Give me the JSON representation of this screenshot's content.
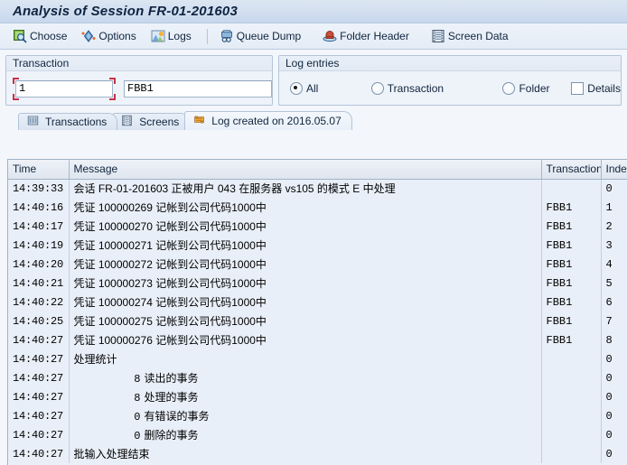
{
  "window": {
    "title": "Analysis of Session FR-01-201603"
  },
  "toolbar": {
    "buttons": [
      {
        "label": "Choose",
        "icon": "choose-magnifier-icon"
      },
      {
        "label": "Options",
        "icon": "options-diamond-icon"
      },
      {
        "label": "Logs",
        "icon": "logs-mountain-icon"
      },
      {
        "label": "Queue Dump",
        "icon": "queue-dump-icon"
      },
      {
        "label": "Folder Header",
        "icon": "folder-header-icon"
      },
      {
        "label": "Screen Data",
        "icon": "screen-data-filmstrip-icon"
      }
    ]
  },
  "transaction_group": {
    "title": "Transaction",
    "index_field": {
      "value": "1",
      "placeholder": ""
    },
    "code_field": {
      "value": "FBB1",
      "placeholder": ""
    }
  },
  "log_entries_group": {
    "title": "Log entries",
    "radios": [
      {
        "label": "All",
        "selected": true
      },
      {
        "label": "Transaction",
        "selected": false
      },
      {
        "label": "Folder",
        "selected": false
      }
    ],
    "checkbox": {
      "label": "Details",
      "checked": false
    }
  },
  "tabs": [
    {
      "label": "Transactions",
      "icon": "grid-columns-icon",
      "active": false
    },
    {
      "label": "Screens",
      "icon": "filmstrip-icon",
      "active": false
    },
    {
      "label": "Log created on 2016.05.07",
      "icon": "log-scroll-icon",
      "active": true
    }
  ],
  "table": {
    "columns": [
      "Time",
      "Message",
      "Transaction",
      "Inde"
    ],
    "rows": [
      {
        "time": "14:39:33",
        "message": "会话 FR-01-201603 正被用户 043 在服务器 vs105 的模式 E 中处理",
        "transaction": "",
        "index": "0",
        "stat": ""
      },
      {
        "time": "14:40:16",
        "message": "凭证 100000269 记帐到公司代码1000中",
        "transaction": "FBB1",
        "index": "1",
        "stat": ""
      },
      {
        "time": "14:40:17",
        "message": "凭证 100000270 记帐到公司代码1000中",
        "transaction": "FBB1",
        "index": "2",
        "stat": ""
      },
      {
        "time": "14:40:19",
        "message": "凭证 100000271 记帐到公司代码1000中",
        "transaction": "FBB1",
        "index": "3",
        "stat": ""
      },
      {
        "time": "14:40:20",
        "message": "凭证 100000272 记帐到公司代码1000中",
        "transaction": "FBB1",
        "index": "4",
        "stat": ""
      },
      {
        "time": "14:40:21",
        "message": "凭证 100000273 记帐到公司代码1000中",
        "transaction": "FBB1",
        "index": "5",
        "stat": ""
      },
      {
        "time": "14:40:22",
        "message": "凭证 100000274 记帐到公司代码1000中",
        "transaction": "FBB1",
        "index": "6",
        "stat": ""
      },
      {
        "time": "14:40:25",
        "message": "凭证 100000275 记帐到公司代码1000中",
        "transaction": "FBB1",
        "index": "7",
        "stat": ""
      },
      {
        "time": "14:40:27",
        "message": "凭证 100000276 记帐到公司代码1000中",
        "transaction": "FBB1",
        "index": "8",
        "stat": ""
      },
      {
        "time": "14:40:27",
        "message": "处理统计",
        "transaction": "",
        "index": "0",
        "stat": ""
      },
      {
        "time": "14:40:27",
        "message": "读出的事务",
        "transaction": "",
        "index": "0",
        "stat": "8"
      },
      {
        "time": "14:40:27",
        "message": "处理的事务",
        "transaction": "",
        "index": "0",
        "stat": "8"
      },
      {
        "time": "14:40:27",
        "message": "有错误的事务",
        "transaction": "",
        "index": "0",
        "stat": "0"
      },
      {
        "time": "14:40:27",
        "message": "删除的事务",
        "transaction": "",
        "index": "0",
        "stat": "0"
      },
      {
        "time": "14:40:27",
        "message": "批输入处理结束",
        "transaction": "",
        "index": "0",
        "stat": ""
      }
    ]
  }
}
